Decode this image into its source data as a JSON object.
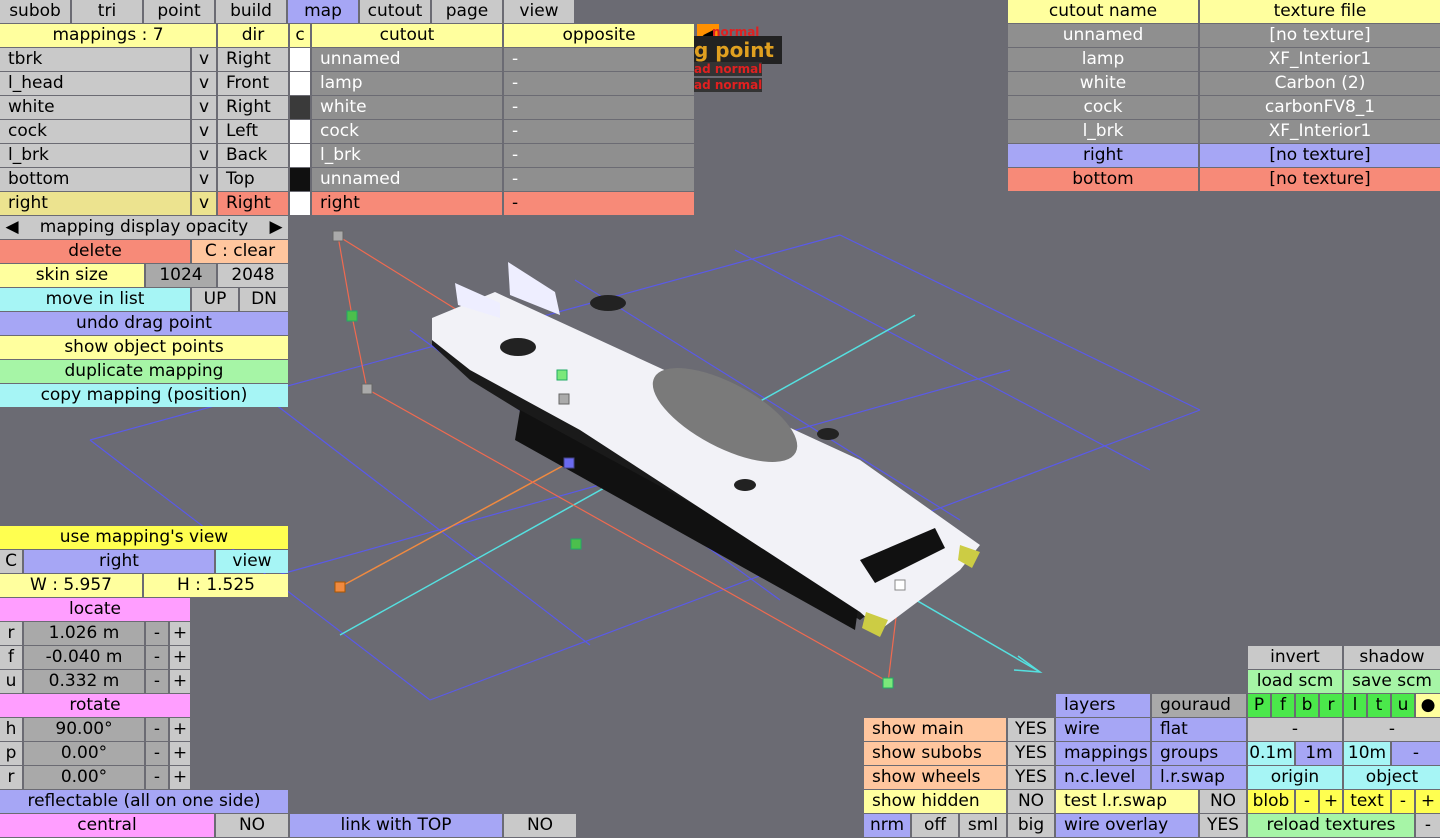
{
  "menu_tabs": [
    "subob",
    "tri",
    "point",
    "build",
    "map",
    "cutout",
    "page",
    "view"
  ],
  "selected_tab": "map",
  "mapping_table": {
    "header_count": "mappings : 7",
    "header_dir": "dir",
    "header_c": "c",
    "header_cutout": "cutout",
    "header_opposite": "opposite",
    "rows": [
      {
        "name": "tbrk",
        "v": "v",
        "dir": "Right",
        "cutout": "unnamed",
        "opposite": "-"
      },
      {
        "name": "l_head",
        "v": "v",
        "dir": "Front",
        "cutout": "lamp",
        "opposite": "-"
      },
      {
        "name": "white",
        "v": "v",
        "dir": "Right",
        "cutout": "white",
        "opposite": "-"
      },
      {
        "name": "cock",
        "v": "v",
        "dir": "Left",
        "cutout": "cock",
        "opposite": "-"
      },
      {
        "name": "l_brk",
        "v": "v",
        "dir": "Back",
        "cutout": "l_brk",
        "opposite": "-"
      },
      {
        "name": "bottom",
        "v": "v",
        "dir": "Top",
        "cutout": "unnamed",
        "opposite": "-"
      },
      {
        "name": "right",
        "v": "v",
        "dir": "Right",
        "cutout": "right",
        "opposite": "-"
      }
    ],
    "swatches": [
      "#ffffff",
      "#ffffff",
      "#3a3a3a",
      "#ffffff",
      "#ffffff",
      "#101010",
      "#ffffff"
    ]
  },
  "overlay_labels": [
    "normal",
    "g point",
    "ad normal",
    "ad normal"
  ],
  "left_panel": {
    "prev": "◀",
    "opacity_label": "mapping display opacity",
    "next": "▶",
    "delete": "delete",
    "clear": "C : clear",
    "skin_size": "skin size",
    "size_1024": "1024",
    "size_2048": "2048",
    "move_in_list": "move in list",
    "up": "UP",
    "dn": "DN",
    "undo_drag": "undo drag point",
    "show_points": "show object points",
    "duplicate": "duplicate mapping",
    "copy_mapping": "copy mapping (position)"
  },
  "view_panel": {
    "use_view": "use mapping's view",
    "c": "C",
    "name": "right",
    "view": "view",
    "w": "W : 5.957",
    "h": "H : 1.525",
    "locate": "locate",
    "locate_rows": [
      {
        "axis": "r",
        "value": "1.026 m"
      },
      {
        "axis": "f",
        "value": "-0.040 m"
      },
      {
        "axis": "u",
        "value": "0.332 m"
      }
    ],
    "rotate": "rotate",
    "rotate_rows": [
      {
        "axis": "h",
        "value": "90.00°"
      },
      {
        "axis": "p",
        "value": "0.00°"
      },
      {
        "axis": "r",
        "value": "0.00°"
      }
    ],
    "minus": "-",
    "plus": "+",
    "reflectable": "reflectable (all on one side)",
    "central": "central",
    "central_val": "NO",
    "link_top": "link with TOP",
    "link_val": "NO"
  },
  "texture_table": {
    "header_name": "cutout name",
    "header_file": "texture file",
    "rows": [
      {
        "name": "unnamed",
        "file": "[no texture]"
      },
      {
        "name": "lamp",
        "file": "XF_Interior1"
      },
      {
        "name": "white",
        "file": "Carbon (2)"
      },
      {
        "name": "cock",
        "file": "carbonFV8_1"
      },
      {
        "name": "l_brk",
        "file": "XF_Interior1"
      },
      {
        "name": "right",
        "file": "[no texture]"
      },
      {
        "name": "bottom",
        "file": "[no texture]"
      }
    ]
  },
  "bottom_right": {
    "show_main": "show main",
    "show_main_val": "YES",
    "show_subobs": "show subobs",
    "show_subobs_val": "YES",
    "show_wheels": "show wheels",
    "show_wheels_val": "YES",
    "show_hidden": "show hidden",
    "show_hidden_val": "NO",
    "nrm": "nrm",
    "off": "off",
    "sml": "sml",
    "big": "big",
    "layers": "layers",
    "gouraud": "gouraud",
    "wire": "wire",
    "flat": "flat",
    "mappings": "mappings",
    "groups": "groups",
    "nc_level": "n.c.level",
    "lr_swap": "l.r.swap",
    "test_lr_swap": "test l.r.swap",
    "test_lr_val": "NO",
    "wire_overlay": "wire overlay",
    "wire_overlay_val": "YES",
    "invert": "invert",
    "shadow": "shadow",
    "load_scm": "load scm",
    "save_scm": "save scm",
    "view_letters": [
      "P",
      "f",
      "b",
      "r",
      "l",
      "t",
      "u",
      "●"
    ],
    "dash": "-",
    "grid_01": "0.1m",
    "grid_1": "1m",
    "grid_10": "10m",
    "origin": "origin",
    "object": "object",
    "blob": "blob",
    "text": "text",
    "reload": "reload textures",
    "reload_minus": "-"
  }
}
